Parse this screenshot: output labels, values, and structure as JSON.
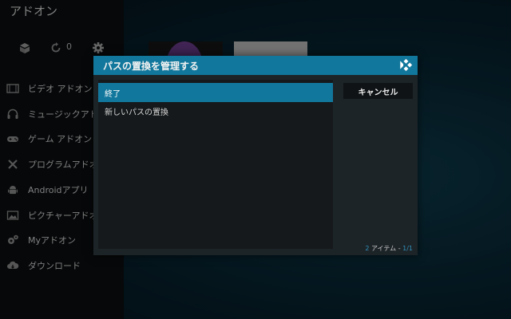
{
  "app": {
    "title": "アドオン"
  },
  "top_bar": {
    "count": "0"
  },
  "sidebar": {
    "items": [
      {
        "label": "ビデオ アドオン",
        "icon": "film-icon"
      },
      {
        "label": "ミュージックアドオン",
        "icon": "headphones-icon"
      },
      {
        "label": "ゲーム アドオン",
        "icon": "gamepad-icon"
      },
      {
        "label": "プログラムアドオン",
        "icon": "tools-icon"
      },
      {
        "label": "Androidアプリ",
        "icon": "android-icon"
      },
      {
        "label": "ピクチャーアドオン",
        "icon": "picture-icon"
      },
      {
        "label": "Myアドオン",
        "icon": "gears-icon"
      },
      {
        "label": "ダウンロード",
        "icon": "cloud-download-icon"
      }
    ]
  },
  "dialog": {
    "title": "パスの置換を管理する",
    "items": [
      {
        "label": "終了",
        "selected": true
      },
      {
        "label": "新しいパスの置換",
        "selected": false
      }
    ],
    "cancel_label": "キャンセル",
    "footer": {
      "count": "2",
      "items_label": " アイテム - ",
      "page": "1/1"
    }
  },
  "colors": {
    "accent": "#12779c",
    "dialog_bg": "#1d2428",
    "list_bg": "#15191b",
    "sidebar_bg": "#0b0d0f"
  }
}
